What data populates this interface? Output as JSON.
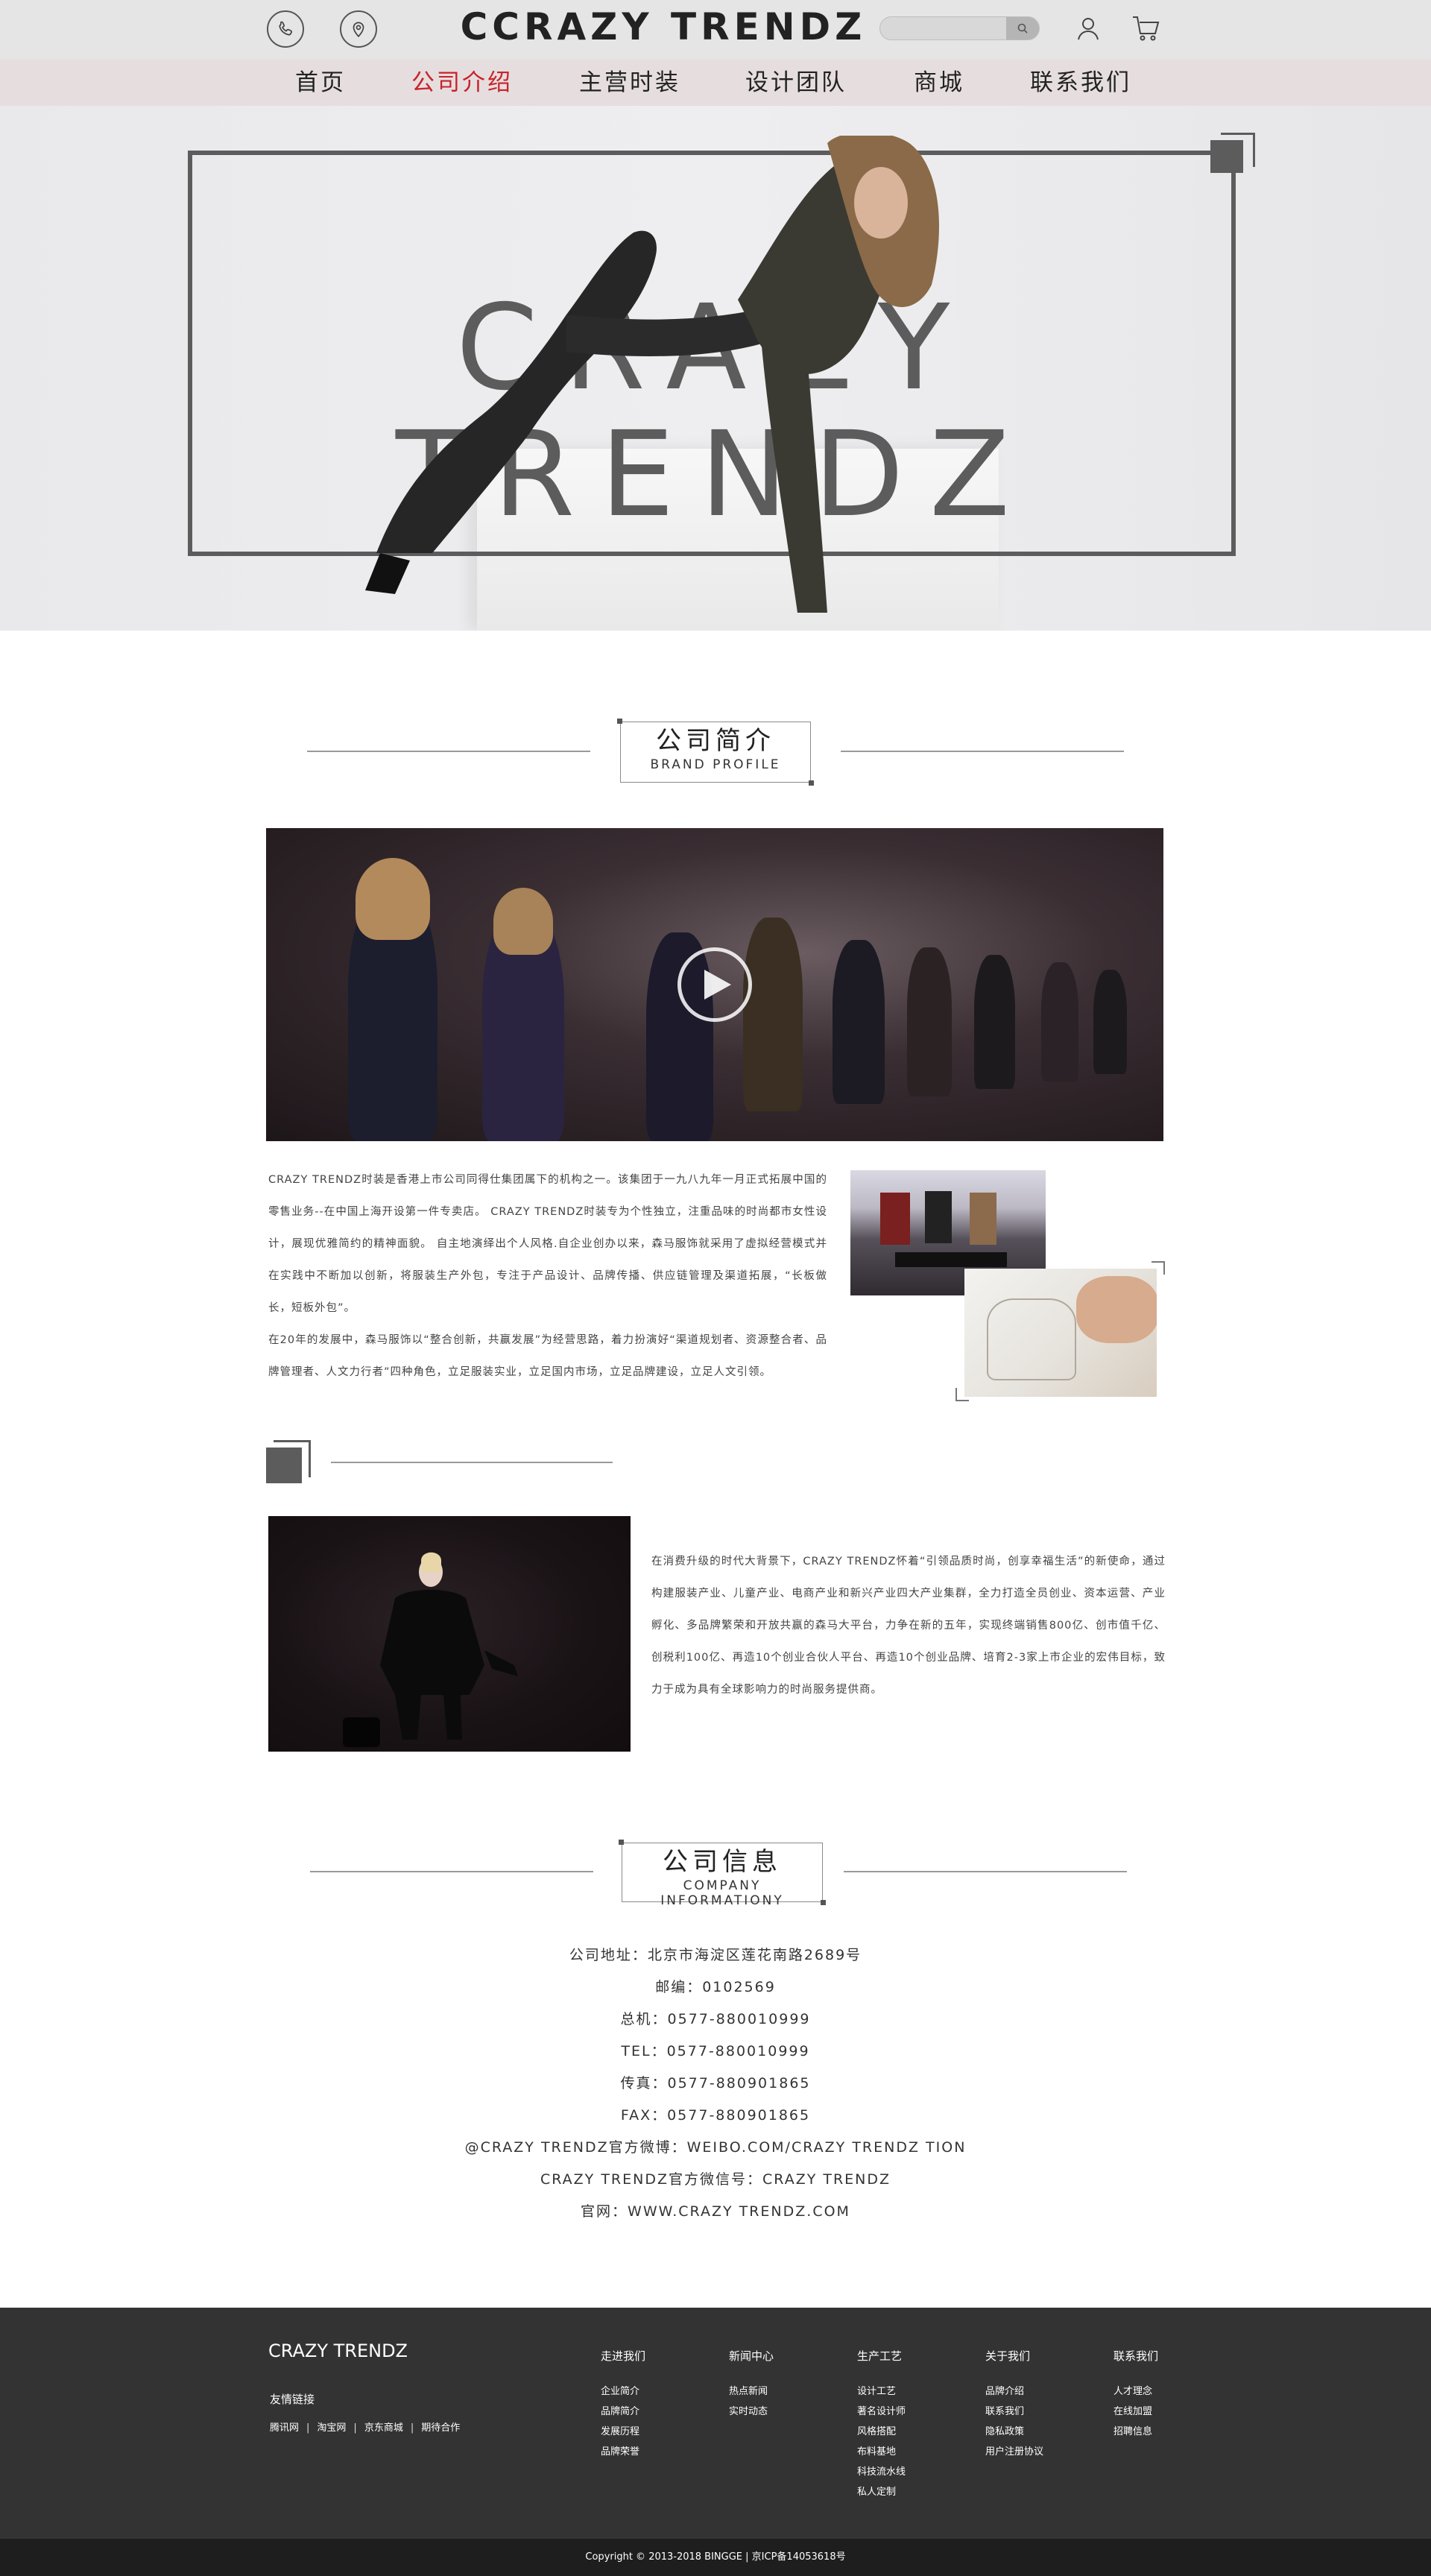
{
  "header": {
    "brand": "CCRAZY TRENDZ",
    "search_placeholder": "",
    "icons": [
      "phone-icon",
      "location-icon",
      "search-icon",
      "user-icon",
      "cart-icon"
    ]
  },
  "nav": {
    "items": [
      {
        "label": "首页"
      },
      {
        "label": "公司介绍"
      },
      {
        "label": "主营时装"
      },
      {
        "label": "设计团队"
      },
      {
        "label": "商城"
      },
      {
        "label": "联系我们"
      }
    ],
    "active_color": "#c8232c"
  },
  "hero": {
    "title": "CRAZY TRENDZ"
  },
  "brand_profile": {
    "title_cn": "公司简介",
    "title_en": "BRAND PROFILE",
    "paragraph_1": "CRAZY TRENDZ时装是香港上市公司同得仕集团属下的机构之一。该集团于一九八九年一月正式拓展中国的零售业务--在中国上海开设第一件专卖店。 CRAZY TRENDZ时装专为个性独立，注重品味的时尚都市女性设计，展现优雅简约的精神面貌。 自主地演绎出个人风格.自企业创办以来，森马服饰就采用了虚拟经营模式并在实践中不断加以创新，将服装生产外包，专注于产品设计、品牌传播、供应链管理及渠道拓展，“长板做长，短板外包”。",
    "paragraph_2": "在20年的发展中，森马服饰以“整合创新，共赢发展”为经营思路，着力扮演好“渠道规划者、资源整合者、品牌管理者、人文力行者”四种角色，立足服装实业，立足国内市场，立足品牌建设，立足人文引领。",
    "paragraph_3": "在消费升级的时代大背景下，CRAZY  TRENDZ怀着“引领品质时尚，创享幸福生活”的新使命，通过构建服装产业、儿童产业、电商产业和新兴产业四大产业集群，全力打造全员创业、资本运营、产业孵化、多品牌繁荣和开放共赢的森马大平台，力争在新的五年，实现终端销售800亿、创市值千亿、创税利100亿、再造10个创业合伙人平台、再造10个创业品牌、培育2-3家上市企业的宏伟目标，致力于成为具有全球影响力的时尚服务提供商。"
  },
  "company_info": {
    "title_cn": "公司信息",
    "title_en": "COMPANY INFORMATIONY",
    "lines": [
      "公司地址：北京市海淀区莲花南路2689号",
      "邮编：0102569",
      "总机：0577-880010999",
      "TEL：0577-880010999",
      "传真：0577-880901865",
      "FAX：0577-880901865",
      "@CRAZY TRENDZ官方微博：WEIBO.COM/CRAZY TRENDZ TION",
      "CRAZY TRENDZ官方微信号：CRAZY TRENDZ",
      "官网：WWW.CRAZY TRENDZ.COM"
    ]
  },
  "footer": {
    "logo": "CRAZY TRENDZ",
    "friend_links_title": "友情链接",
    "friend_links": [
      "腾讯网",
      "淘宝网",
      "京东商城",
      "期待合作"
    ],
    "columns": [
      {
        "title": "走进我们",
        "items": [
          "企业简介",
          "品牌简介",
          "发展历程",
          "品牌荣誉"
        ]
      },
      {
        "title": "新闻中心",
        "items": [
          "热点新闻",
          "实时动态"
        ]
      },
      {
        "title": "生产工艺",
        "items": [
          "设计工艺",
          "著名设计师",
          "风格搭配",
          "布料基地",
          "科技流水线",
          "私人定制"
        ]
      },
      {
        "title": "关于我们",
        "items": [
          "品牌介绍",
          "联系我们",
          "隐私政策",
          "用户注册协议"
        ]
      },
      {
        "title": "联系我们",
        "items": [
          "人才理念",
          "在线加盟",
          "招聘信息"
        ]
      }
    ],
    "copyright": "Copyright © 2013-2018 BINGGE | 京ICP备14053618号"
  }
}
